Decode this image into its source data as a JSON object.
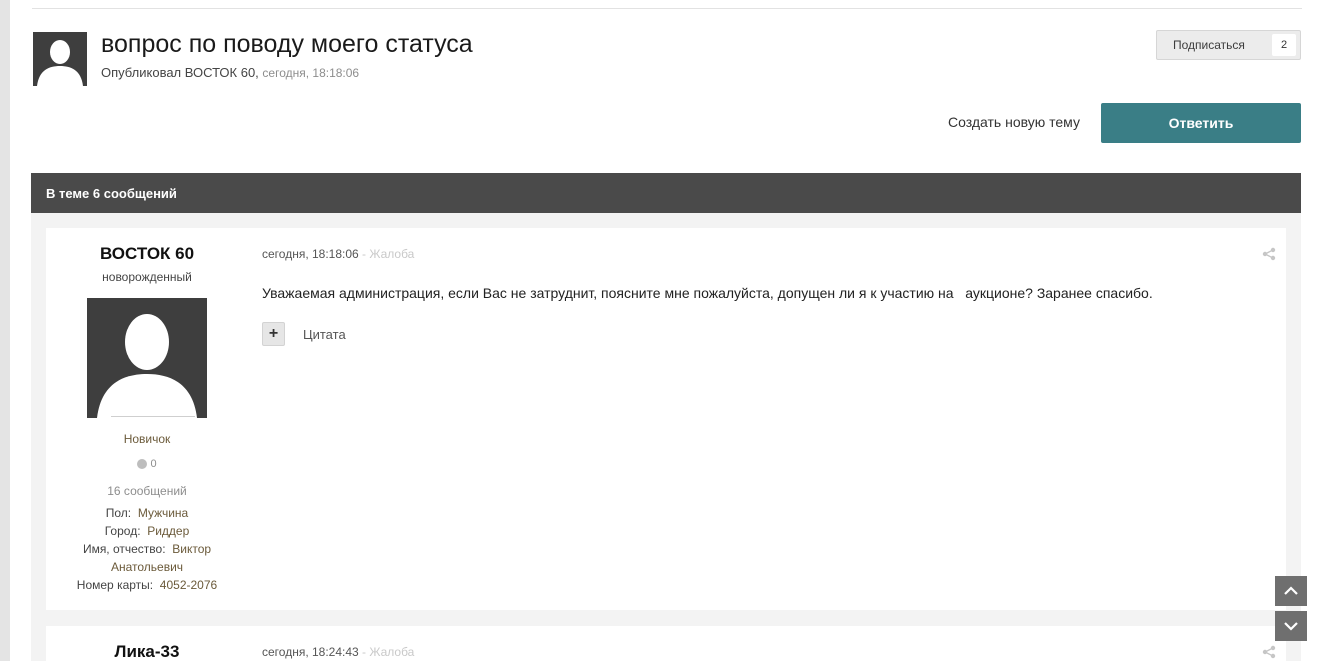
{
  "topic": {
    "title": "вопрос по поводу моего статуса",
    "meta_prefix": "Опубликовал ВОСТОК 60, ",
    "meta_time": "сегодня, 18:18:06"
  },
  "follow": {
    "label": "Подписаться",
    "count": "2"
  },
  "actions": {
    "new_topic": "Создать новую тему",
    "reply": "Ответить"
  },
  "section": {
    "title": "В теме 6 сообщений"
  },
  "posts": [
    {
      "author": "ВОСТОК 60",
      "author_title": "новорожденный",
      "rank": "Новичок",
      "reputation": "0",
      "post_count": "16 сообщений",
      "fields": [
        {
          "label": "Пол:",
          "value": "Мужчина"
        },
        {
          "label": "Город:",
          "value": "Риддер"
        },
        {
          "label": "Имя, отчество:",
          "value": "Виктор Анатольевич"
        },
        {
          "label": "Номер карты:",
          "value": "4052-2076"
        }
      ],
      "date": "сегодня, 18:18:06",
      "report": " - Жалоба",
      "text": "Уважаемая администрация, если Вас не затруднит, поясните мне пожалуйста, допущен ли я к участию на   аукционе? Заранее спасибо.",
      "multiquote": "+",
      "quote": "Цитата"
    },
    {
      "author": "Лика-33",
      "date": "сегодня, 18:24:43",
      "report": " - Жалоба"
    }
  ],
  "colors": {
    "accent": "#3a7e86",
    "section_bar": "#4a4a4a"
  },
  "icons": {
    "share": "share-icon",
    "scroll_up": "chevron-up-icon",
    "scroll_down": "chevron-down-icon"
  }
}
